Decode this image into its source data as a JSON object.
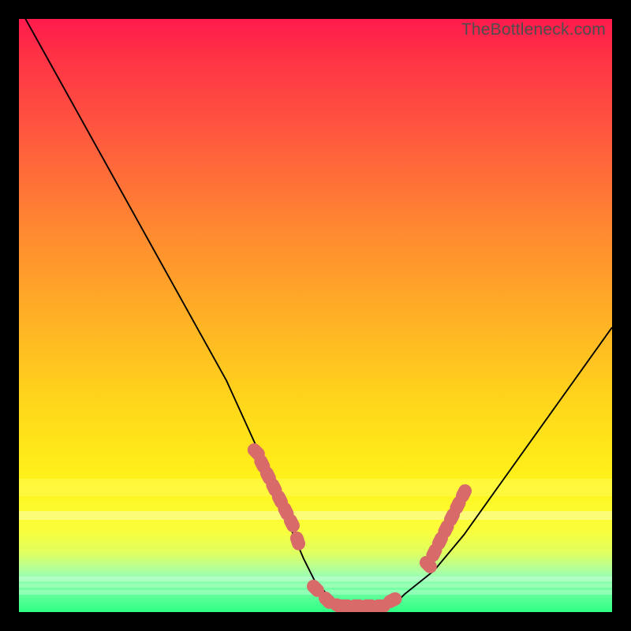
{
  "watermark": "TheBottleneck.com",
  "colors": {
    "frame": "#000000",
    "curve": "#000000",
    "marker": "#d86a6a"
  },
  "chart_data": {
    "type": "line",
    "title": "",
    "xlabel": "",
    "ylabel": "",
    "xlim": [
      0,
      100
    ],
    "ylim": [
      0,
      100
    ],
    "grid": false,
    "legend": false,
    "series": [
      {
        "name": "bottleneck-curve",
        "x": [
          0,
          5,
          10,
          15,
          20,
          25,
          30,
          35,
          40,
          42,
          45,
          48,
          50,
          53,
          55,
          58,
          60,
          63,
          65,
          70,
          75,
          80,
          85,
          90,
          95,
          100
        ],
        "y": [
          102,
          93,
          84,
          75,
          66,
          57,
          48,
          39,
          28,
          23,
          16,
          9,
          5,
          2,
          1,
          1,
          1,
          1,
          3,
          7,
          13,
          20,
          27,
          34,
          41,
          48
        ]
      }
    ],
    "markers": [
      {
        "name": "left-cluster",
        "x": [
          40,
          41,
          42,
          43,
          44,
          45,
          46,
          47
        ],
        "y": [
          27,
          25,
          23,
          21,
          19,
          17,
          15,
          12
        ]
      },
      {
        "name": "valley-cluster",
        "x": [
          50,
          52,
          54,
          55,
          57,
          59,
          61,
          63
        ],
        "y": [
          4,
          2,
          1,
          1,
          1,
          1,
          1,
          2
        ]
      },
      {
        "name": "right-cluster",
        "x": [
          69,
          70,
          71,
          72,
          73,
          74,
          75
        ],
        "y": [
          8,
          10,
          12,
          14,
          16,
          18,
          20
        ]
      }
    ],
    "marker_style": {
      "shape": "rounded-dash",
      "size": 3.2
    }
  }
}
